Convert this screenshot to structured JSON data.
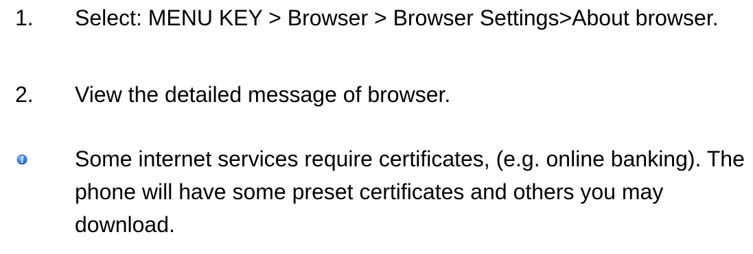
{
  "steps": [
    {
      "number": "1.",
      "text": "Select: MENU KEY > Browser > Browser Settings>About browser."
    },
    {
      "number": "2.",
      "text": "View the detailed message of browser."
    }
  ],
  "note": {
    "icon": "info-icon",
    "icon_color": "#2f6fd0",
    "text": "Some internet services require certificates, (e.g. online banking). The phone will have some preset certificates and others you may download."
  }
}
